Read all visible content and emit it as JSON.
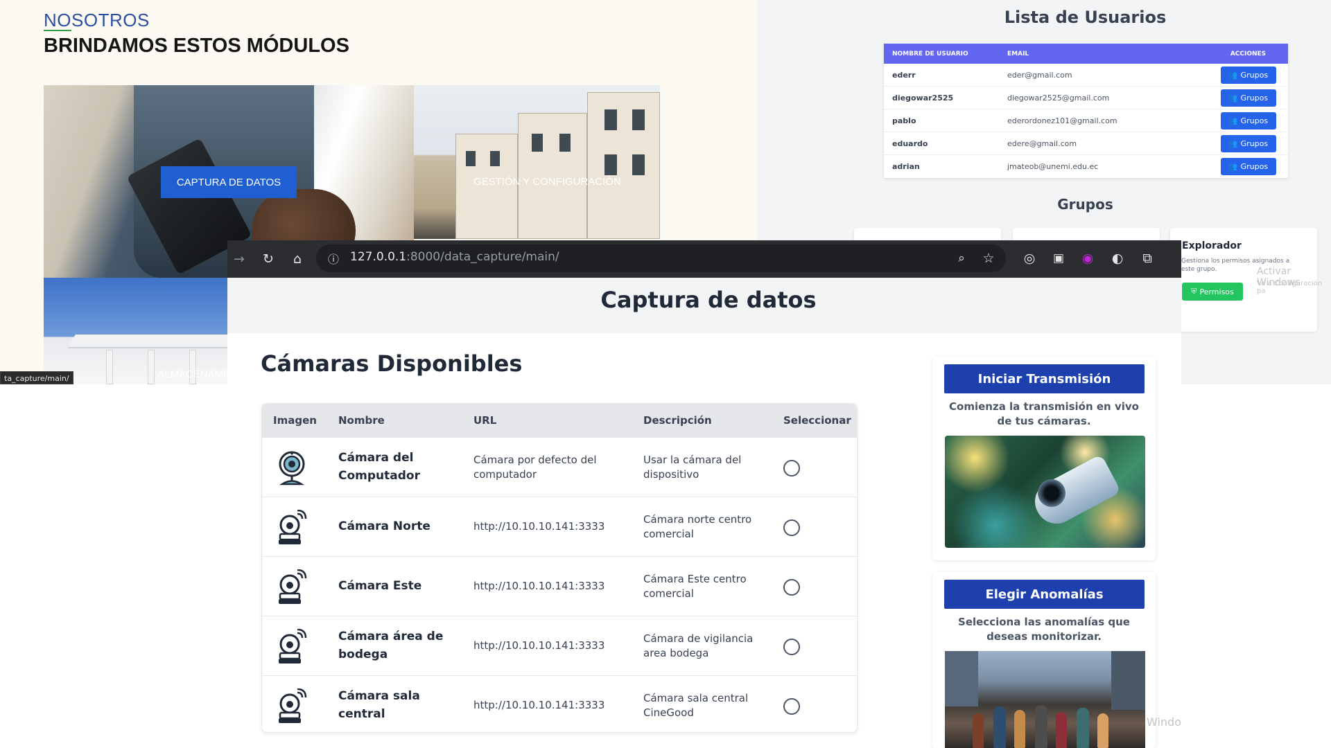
{
  "nosotros": {
    "kicker": "NOSOTROS",
    "title": "BRINDAMOS ESTOS MÓDULOS",
    "tiles": {
      "captura": "CAPTURA DE DATOS",
      "gestion": "GESTIÓN Y CONFIGURACIÓN",
      "almacenamiento": "ALMACENAMIEN"
    },
    "status_url": "ta_capture/main/"
  },
  "usuarios": {
    "title": "Lista de Usuarios",
    "columns": [
      "NOMBRE DE USUARIO",
      "EMAIL",
      "ACCIONES"
    ],
    "rows": [
      {
        "username": "ederr",
        "email": "eder@gmail.com",
        "action": "Grupos"
      },
      {
        "username": "diegowar2525",
        "email": "diegowar2525@gmail.com",
        "action": "Grupos"
      },
      {
        "username": "pablo",
        "email": "ederordonez101@gmail.com",
        "action": "Grupos"
      },
      {
        "username": "eduardo",
        "email": "edere@gmail.com",
        "action": "Grupos"
      },
      {
        "username": "adrian",
        "email": "jmateob@unemi.edu.ec",
        "action": "Grupos"
      }
    ],
    "grupos_title": "Grupos",
    "explorador": {
      "title": "Explorador",
      "description": "Gestiona los permisos asignados a este grupo.",
      "button": "Permisos"
    },
    "watermark_line1": "Activar Windows",
    "watermark_line2": "Ve a Configuración pa"
  },
  "browser": {
    "url_host": "127.0.0.1",
    "url_path": ":8000/data_capture/main/",
    "icons": [
      "forward-icon",
      "reload-icon",
      "home-icon",
      "site-info-icon",
      "zoom-icon",
      "bookmark-star-icon",
      "extension-icons",
      "puzzle-icon"
    ]
  },
  "main": {
    "title": "Captura de datos",
    "cameras_title": "Cámaras Disponibles",
    "columns": [
      "Imagen",
      "Nombre",
      "URL",
      "Descripción",
      "Seleccionar"
    ],
    "cameras": [
      {
        "name": "Cámara del Computador",
        "url": "Cámara por defecto del computador",
        "description": "Usar la cámara del dispositivo",
        "icon": "webcam-icon"
      },
      {
        "name": "Cámara Norte",
        "url": "http://10.10.10.141:3333",
        "description": "Cámara norte centro comercial",
        "icon": "ip-camera-icon"
      },
      {
        "name": "Cámara Este",
        "url": "http://10.10.10.141:3333",
        "description": "Cámara Este centro comercial",
        "icon": "ip-camera-icon"
      },
      {
        "name": "Cámara área de bodega",
        "url": "http://10.10.10.141:3333",
        "description": "Cámara de vigilancia area bodega",
        "icon": "ip-camera-icon"
      },
      {
        "name": "Cámara sala central",
        "url": "http://10.10.10.141:3333",
        "description": "Cámara sala central CineGood",
        "icon": "ip-camera-icon"
      }
    ],
    "stream_card": {
      "button": "Iniciar Transmisión",
      "text": "Comienza la transmisión en vivo de tus cámaras."
    },
    "anomaly_card": {
      "button": "Elegir Anomalías",
      "text": "Selecciona las anomalías que deseas monitorizar."
    },
    "watermark": "Windo"
  },
  "colors": {
    "primary_blue": "#1e40af",
    "table_header_purple": "#6366f1",
    "grupos_button": "#2563eb",
    "permisos_green": "#22c55e",
    "captura_tile_button": "#1f5fd1"
  }
}
